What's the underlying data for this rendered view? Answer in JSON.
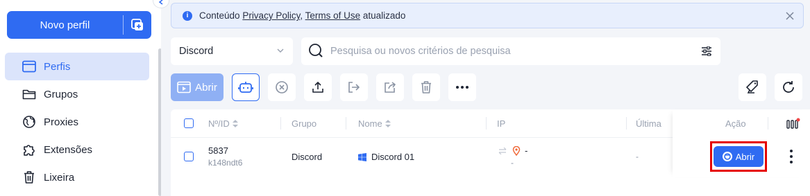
{
  "sidebar": {
    "new_profile_label": "Novo perfil",
    "items": [
      {
        "label": "Perfis",
        "icon": "window-icon",
        "active": true
      },
      {
        "label": "Grupos",
        "icon": "folder-icon",
        "active": false
      },
      {
        "label": "Proxies",
        "icon": "globe-icon",
        "active": false
      },
      {
        "label": "Extensões",
        "icon": "puzzle-icon",
        "active": false
      },
      {
        "label": "Lixeira",
        "icon": "trash-icon",
        "active": false
      }
    ]
  },
  "notice": {
    "prefix": "Conteúdo ",
    "link1": "Privacy Policy",
    "comma": ", ",
    "link2": "Terms of Use",
    "suffix": " atualizado"
  },
  "filters": {
    "group_value": "Discord",
    "search_placeholder": "Pesquisa ou novos critérios de pesquisa"
  },
  "toolbar": {
    "open_label": "Abrir"
  },
  "table": {
    "headers": {
      "id": "Nº/ID",
      "group": "Grupo",
      "name": "Nome",
      "ip": "IP",
      "last": "Última",
      "action": "Ação"
    },
    "rows": [
      {
        "number": "5837",
        "id": "k148ndt6",
        "group": "Discord",
        "name": "Discord 01",
        "ip": "-",
        "ip_sub": "-",
        "last": "-",
        "action_label": "Abrir"
      }
    ]
  },
  "colors": {
    "accent": "#2f6bf2",
    "accent_light": "#8fb0f4",
    "highlight": "#e60000"
  }
}
